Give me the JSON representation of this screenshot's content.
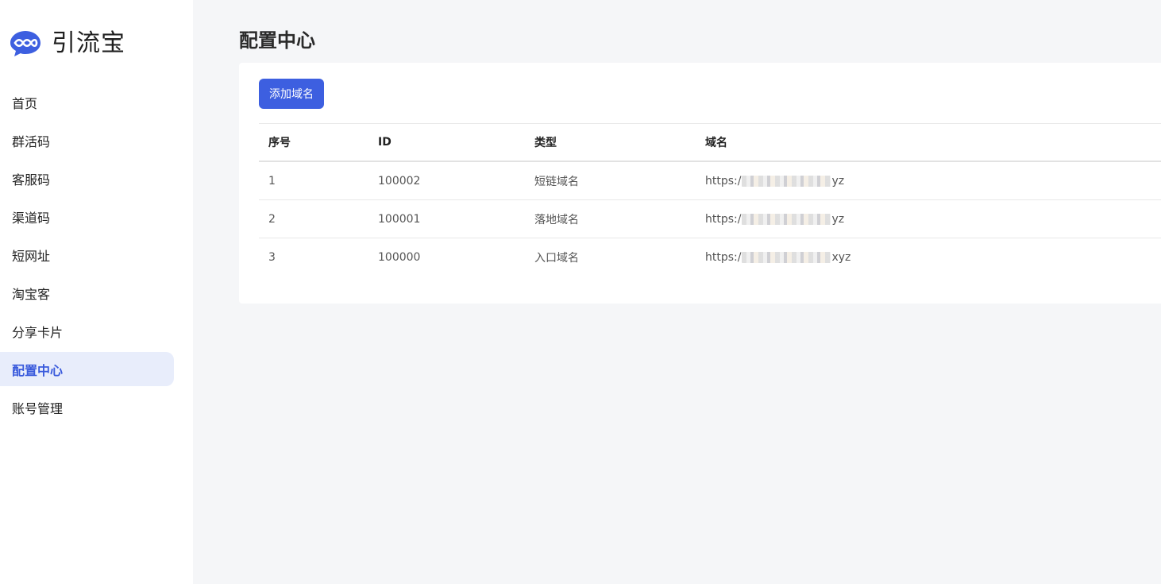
{
  "brand": {
    "name": "引流宝",
    "logo_icon": "chain-bubble-icon",
    "logo_color": "#3d5fe0"
  },
  "nav": {
    "items": [
      {
        "label": "首页"
      },
      {
        "label": "群活码"
      },
      {
        "label": "客服码"
      },
      {
        "label": "渠道码"
      },
      {
        "label": "短网址"
      },
      {
        "label": "淘宝客"
      },
      {
        "label": "分享卡片"
      },
      {
        "label": "配置中心",
        "active": true
      },
      {
        "label": "账号管理"
      }
    ]
  },
  "main": {
    "title": "配置中心",
    "add_button_label": "添加域名",
    "table": {
      "headers": [
        "序号",
        "ID",
        "类型",
        "域名"
      ],
      "rows": [
        {
          "index": "1",
          "id": "100002",
          "type": "短链域名",
          "domain_prefix": "https:/",
          "domain_suffix": "yz"
        },
        {
          "index": "2",
          "id": "100001",
          "type": "落地域名",
          "domain_prefix": "https:/",
          "domain_suffix": "yz"
        },
        {
          "index": "3",
          "id": "100000",
          "type": "入口域名",
          "domain_prefix": "https:/",
          "domain_suffix": "xyz"
        }
      ]
    }
  },
  "colors": {
    "accent": "#3d5fe0",
    "active_bg": "#e8edfb",
    "page_bg": "#f5f6f8"
  }
}
